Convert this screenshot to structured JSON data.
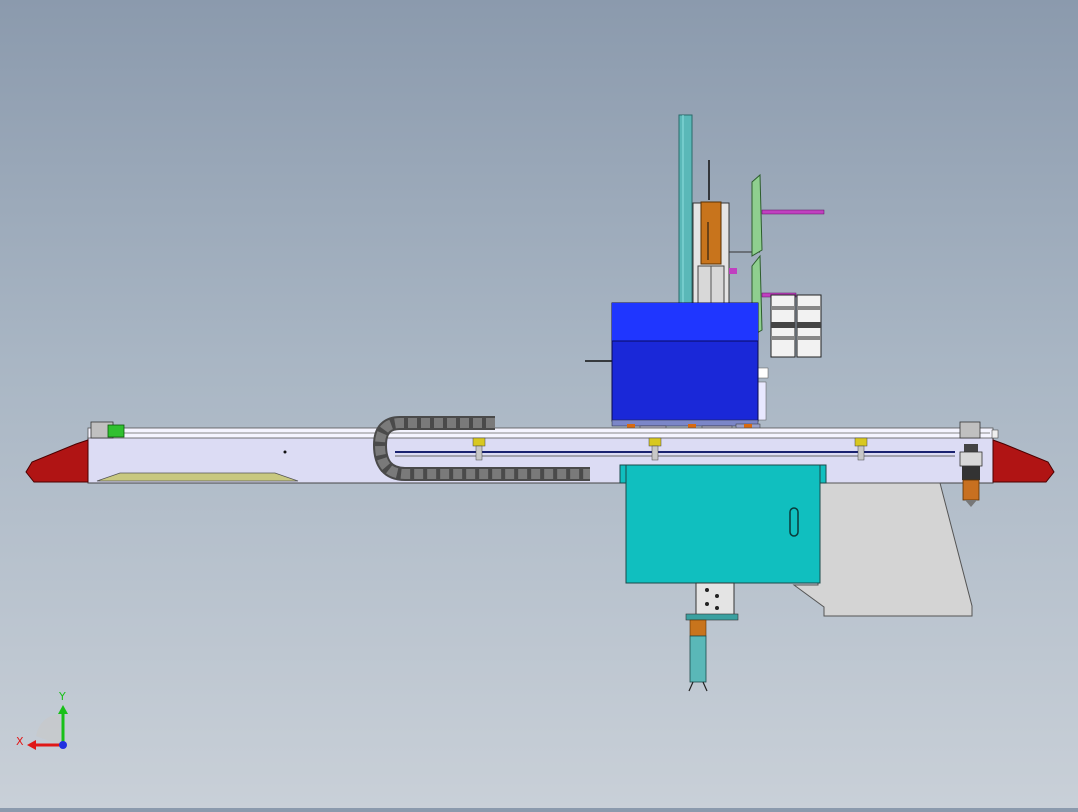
{
  "view": {
    "background_top": "#8b9aad",
    "background_bottom": "#c9d0d8"
  },
  "triad": {
    "x_label": "X",
    "y_label": "Y",
    "x_color": "#e01818",
    "y_color": "#18c018",
    "z_color": "#2030e0"
  },
  "model_colors": {
    "beam": "#dcdcf4",
    "end_cap": "#b01414",
    "carriage_box": "#1a28d8",
    "cabinet": "#10bfbf",
    "bracket_plate": "#d4d4d4",
    "cable_chain": "#4a4a4a",
    "green_plate": "#8fcf8f",
    "magenta_rod": "#c040c0",
    "orange_block": "#c8741c",
    "teal_column": "#5ab8b8"
  }
}
